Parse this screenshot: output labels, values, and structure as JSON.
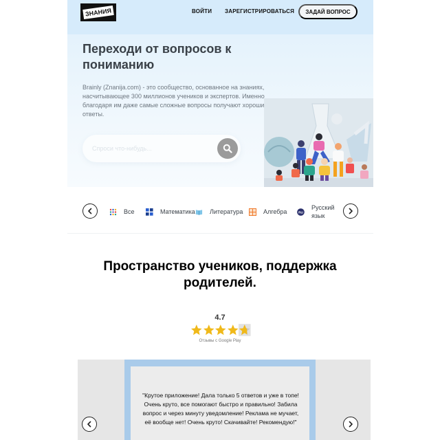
{
  "header": {
    "logo_text": "ЗНАНИЯ",
    "login_label": "ВОЙТИ",
    "register_label": "ЗАРЕГИСТРИРОВАТЬСЯ",
    "ask_label": "ЗАДАЙ ВОПРОС"
  },
  "hero": {
    "title": "Переходи от вопросов к пониманию",
    "description": "Brainly (Znanija.com) - это сообщество, основанное на знаниях, насчитывающее 300 миллионов учеников и экспертов. Именно благодаря им даже самые сложные вопросы получают хорошие ответы.",
    "search_placeholder": "Спроси что-нибудь...",
    "illustration_icon": "students-illustration"
  },
  "subjects": {
    "items": [
      {
        "label": "Все",
        "icon": "all-subjects-icon"
      },
      {
        "label": "Математика",
        "icon": "math-icon"
      },
      {
        "label": "Литература",
        "icon": "literature-icon"
      },
      {
        "label": "Алгебра",
        "icon": "algebra-icon"
      },
      {
        "label": "Русский язык",
        "icon": "russian-language-icon"
      }
    ],
    "russian_badge": "RU"
  },
  "community": {
    "title": "Пространство учеников, поддержка родителей.",
    "rating": "4.7",
    "rating_source": "Отзывы с Google Play",
    "stars": 4.7
  },
  "review": {
    "text": "\"Крутое приложение! Дала только 5 ответов и уже в топе! Очень круто, все помогают быстро и правильно! Забила вопрос и через минуту уведомление! Реклама не мучает, её вообще нет! Очень круто! Скачивайте! Рекомендую!\""
  },
  "colors": {
    "header_bg": "#d6ebfb",
    "star": "#f0b91a",
    "review_frame": "#a9cbea"
  }
}
